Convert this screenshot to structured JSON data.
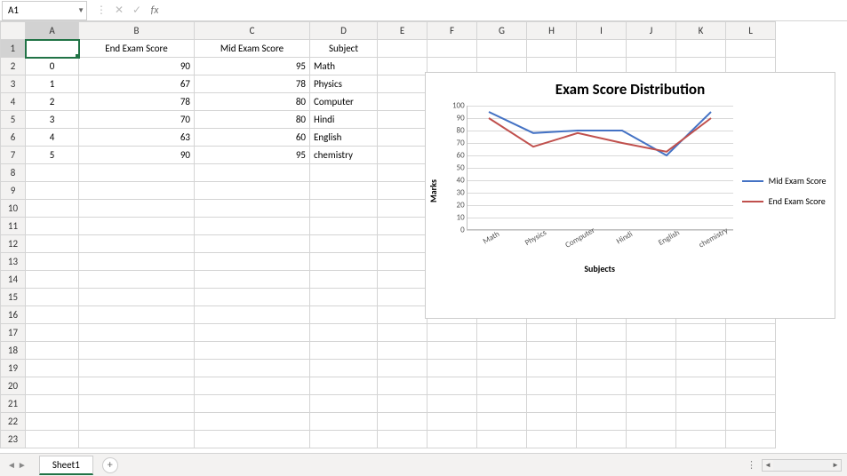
{
  "formula_bar": {
    "cell_ref": "A1",
    "fx_label": "fx",
    "formula_value": ""
  },
  "columns": [
    "A",
    "B",
    "C",
    "D",
    "E",
    "F",
    "G",
    "H",
    "I",
    "J",
    "K",
    "L"
  ],
  "rows": [
    "1",
    "2",
    "3",
    "4",
    "5",
    "6",
    "7",
    "8",
    "9",
    "10",
    "11",
    "12",
    "13",
    "14",
    "15",
    "16",
    "17",
    "18",
    "19",
    "20",
    "21",
    "22",
    "23"
  ],
  "active_cell": "A1",
  "table": {
    "headers": {
      "A": "",
      "B": "End Exam Score",
      "C": "Mid Exam Score",
      "D": "Subject"
    },
    "rows": [
      {
        "idx": "0",
        "end": "90",
        "mid": "95",
        "subject": "Math"
      },
      {
        "idx": "1",
        "end": "67",
        "mid": "78",
        "subject": "Physics"
      },
      {
        "idx": "2",
        "end": "78",
        "mid": "80",
        "subject": "Computer"
      },
      {
        "idx": "3",
        "end": "70",
        "mid": "80",
        "subject": "Hindi"
      },
      {
        "idx": "4",
        "end": "63",
        "mid": "60",
        "subject": "English"
      },
      {
        "idx": "5",
        "end": "90",
        "mid": "95",
        "subject": "chemistry"
      }
    ]
  },
  "chart_data": {
    "type": "line",
    "title": "Exam Score Distribution",
    "xlabel": "Subjects",
    "ylabel": "Marks",
    "categories": [
      "Math",
      "Physics",
      "Computer",
      "Hindi",
      "English",
      "chemistry"
    ],
    "series": [
      {
        "name": "Mid Exam Score",
        "color": "#4472c4",
        "values": [
          95,
          78,
          80,
          80,
          60,
          95
        ]
      },
      {
        "name": "End Exam Score",
        "color": "#c0504d",
        "values": [
          90,
          67,
          78,
          70,
          63,
          90
        ]
      }
    ],
    "ylim": [
      0,
      100
    ],
    "yticks": [
      0,
      10,
      20,
      30,
      40,
      50,
      60,
      70,
      80,
      90,
      100
    ],
    "legend_position": "right"
  },
  "sheet_tabs": {
    "active": "Sheet1",
    "add_label": "+"
  }
}
